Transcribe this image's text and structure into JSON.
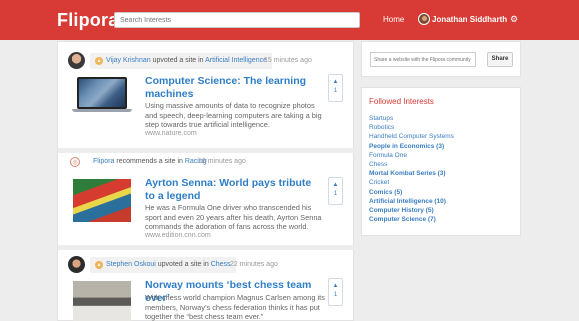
{
  "header": {
    "brand": "Flipora",
    "search_placeholder": "Search Interests",
    "home_label": "Home",
    "user_name": "Jonathan Siddharth",
    "settings_icon": "gear-icon",
    "bar_color": "#d83a35"
  },
  "feed": [
    {
      "actor": "Vijay Krishnan",
      "action": "upvoted a site in",
      "topic": "Artificial Intelligence",
      "time_ago": "15 minutes ago",
      "title": "Computer Science: The learning machines",
      "summary": "Using massive amounts of data to recognize photos and speech, deep-learning computers are taking a big step towards true artificial intelligence.",
      "source": "www.nature.com",
      "votes": "1"
    },
    {
      "actor": "Flipora",
      "action": "recommends a site in",
      "topic": "Racing",
      "time_ago": "18 minutes ago",
      "title": "Ayrton Senna: World pays tribute to a legend",
      "summary": "He was a Formula One driver who transcended his sport and even 20 years after his death, Ayrton Senna commands the adoration of fans across the world.",
      "source": "www.edition.cnn.com",
      "votes": "1"
    },
    {
      "actor": "Stephen Oskoui",
      "action": "upvoted a site in",
      "topic": "Chess",
      "time_ago": "22 minutes ago",
      "title": "Norway mounts ‘best chess team ever’",
      "summary": "With chess world champion Magnus Carlsen among its members, Norway’s chess federation thinks it has put together the “best chess team ever.”",
      "source": "",
      "votes": "1"
    }
  ],
  "sidebar": {
    "share_placeholder": "Share a website with the Flipora community",
    "share_button": "Share",
    "followed_title": "Followed Interests",
    "interests": [
      {
        "label": "Startups",
        "bold": false
      },
      {
        "label": "Robotics",
        "bold": false
      },
      {
        "label": "Handheld Computer Systems",
        "bold": false
      },
      {
        "label": "People in Economics (3)",
        "bold": true
      },
      {
        "label": "Formula One",
        "bold": false
      },
      {
        "label": "Chess",
        "bold": false
      },
      {
        "label": "Mortal Kombat Series (3)",
        "bold": true
      },
      {
        "label": "Cricket",
        "bold": false
      },
      {
        "label": "Comics (5)",
        "bold": true
      },
      {
        "label": "Artificial Intelligence (10)",
        "bold": true
      },
      {
        "label": "Computer History (5)",
        "bold": true
      },
      {
        "label": "Computer Science (7)",
        "bold": true
      }
    ]
  }
}
